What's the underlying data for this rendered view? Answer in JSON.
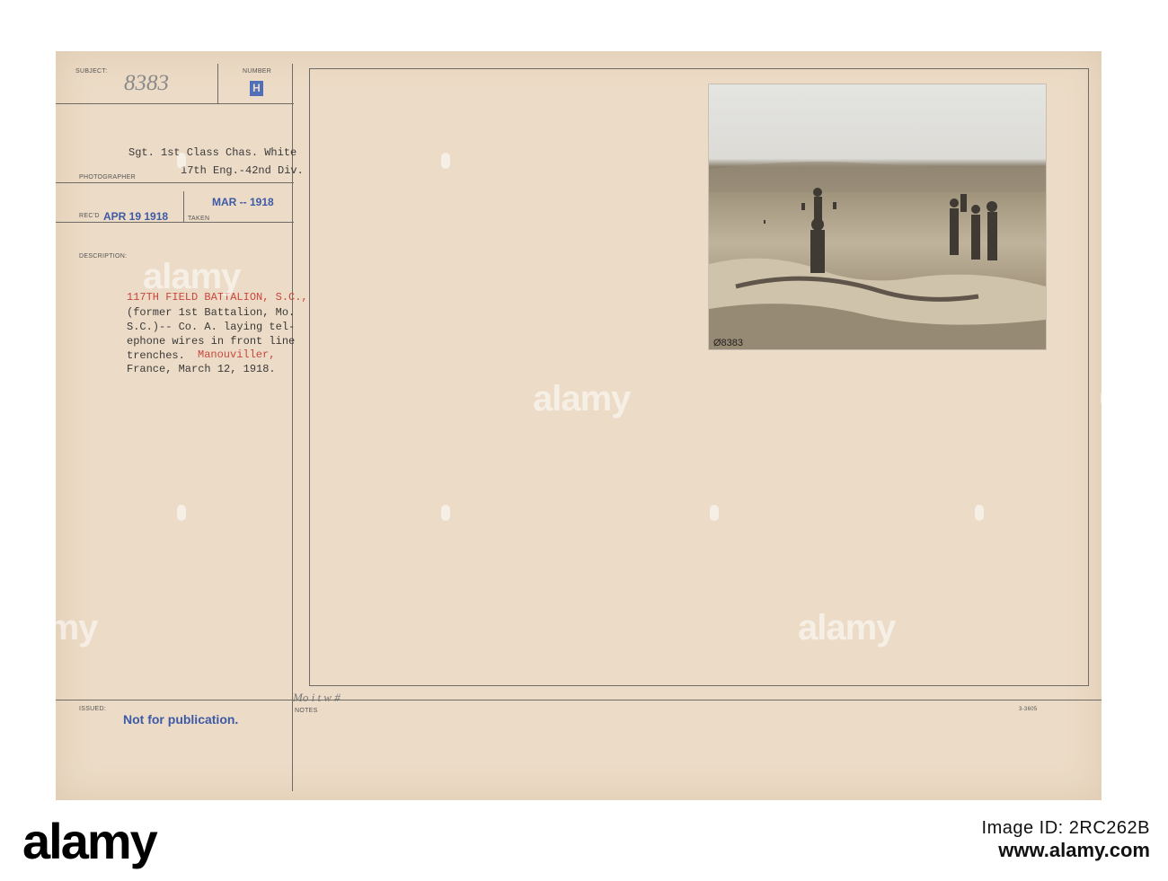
{
  "card": {
    "labels": {
      "subject": "SUBJECT:",
      "number": "NUMBER",
      "photographer": "PHOTOGRAPHER",
      "recd": "REC'D",
      "taken": "TAKEN",
      "description": "DESCRIPTION:",
      "issued": "ISSUED:",
      "notes": "NOTES"
    },
    "subject_number": "8383",
    "number_mark": "H",
    "photographer_line1": "Sgt. 1st Class Chas. White",
    "photographer_line2": "17th Eng.-42nd Div.",
    "received_stamp": "APR 19 1918",
    "taken_stamp": "MAR -- 1918",
    "description_title": "117TH FIELD BATTALION, S.C.,",
    "description_body": "(former 1st Battalion, Mo.\nS.C.)-- Co. A. laying tel-\nephone wires in front line\ntrenches.",
    "description_place": "Manouviller,",
    "description_date": "France, March 12, 1918.",
    "issued_stamp": "Not for publication.",
    "notes_handwriting": "Mo i t w #",
    "form_code": "3-3605",
    "photo_caption": "Ø8383"
  },
  "watermark": {
    "text": "alamy"
  },
  "footer": {
    "logo": "alamy",
    "image_code": "2RC262B",
    "site": "www.alamy.com"
  }
}
